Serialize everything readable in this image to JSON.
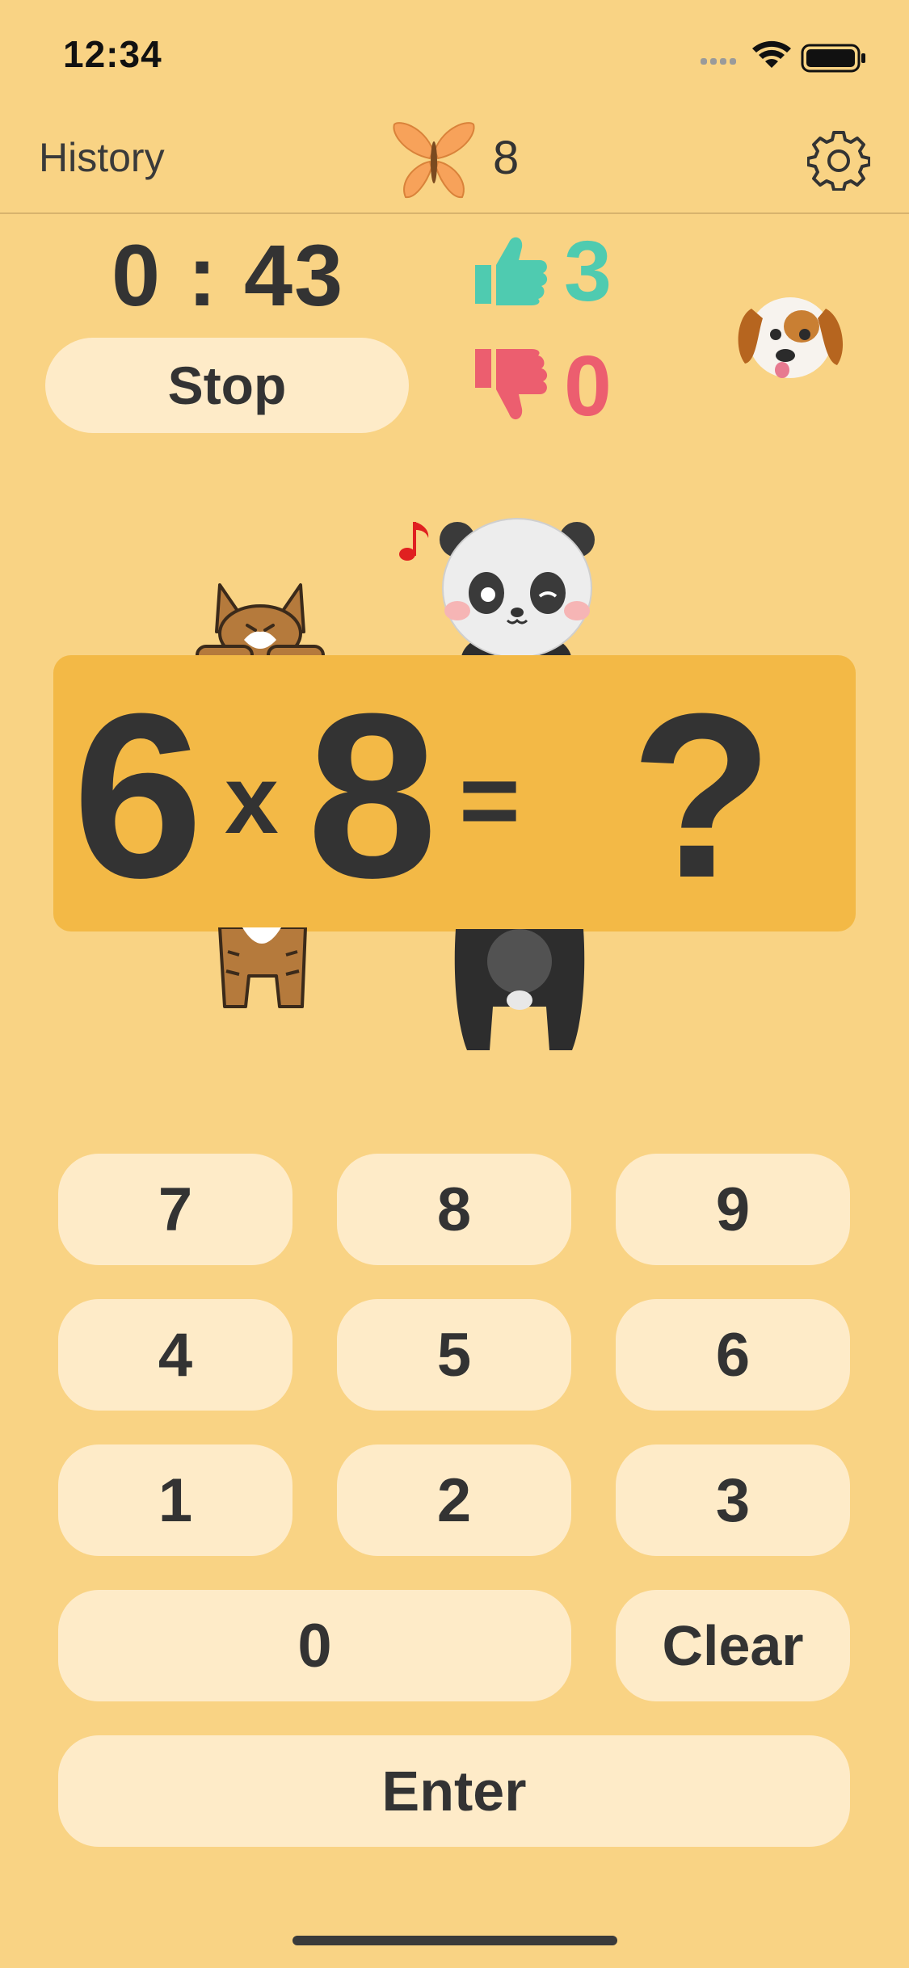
{
  "status_bar": {
    "time": "12:34"
  },
  "nav": {
    "history_label": "History",
    "butterfly_count": "8",
    "settings_icon": "gear-icon"
  },
  "stats": {
    "timer": "0 : 43",
    "stop_label": "Stop",
    "correct": "3",
    "wrong": "0"
  },
  "question": {
    "a": "6",
    "operator": "x",
    "b": "8",
    "equals": "=",
    "answer": "?"
  },
  "keypad": {
    "k7": "7",
    "k8": "8",
    "k9": "9",
    "k4": "4",
    "k5": "5",
    "k6": "6",
    "k1": "1",
    "k2": "2",
    "k3": "3",
    "k0": "0",
    "clear": "Clear",
    "enter": "Enter"
  },
  "colors": {
    "background": "#F9D384",
    "panel": "#F3B946",
    "key": "#FEEBC8",
    "correct": "#4FCBB0",
    "wrong": "#EC5E6F"
  }
}
